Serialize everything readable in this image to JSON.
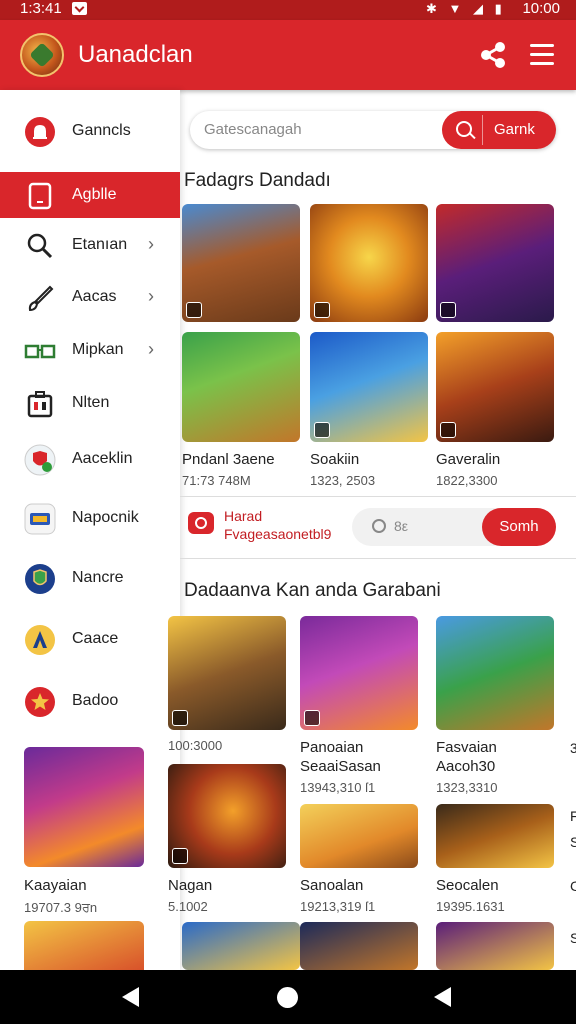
{
  "status_bar": {
    "time_left": "1:3:41",
    "time_right": "10:00",
    "icons": "✱ ▼ ◢ ▮"
  },
  "app_bar": {
    "title": "Uanadclan"
  },
  "search": {
    "placeholder": "Gatescanagah",
    "button_label": "Garnk"
  },
  "sidebar": {
    "items": [
      {
        "label": "Ganncls",
        "icon": "bell-icon",
        "chevron": false,
        "active": false
      },
      {
        "label": "Agblle",
        "icon": "tablet-icon",
        "chevron": false,
        "active": true
      },
      {
        "label": "Etanıan",
        "icon": "search-icon",
        "chevron": true,
        "active": false
      },
      {
        "label": "Aacas",
        "icon": "brush-icon",
        "chevron": true,
        "active": false
      },
      {
        "label": "Mipkan",
        "icon": "glasses-icon",
        "chevron": true,
        "active": false
      },
      {
        "label": "Nlten",
        "icon": "toolbox-icon",
        "chevron": false,
        "active": false
      },
      {
        "label": "Aaceklin",
        "icon": "shield-app-icon",
        "chevron": false,
        "active": false
      },
      {
        "label": "Napocnik",
        "icon": "team-app-icon",
        "chevron": false,
        "active": false
      },
      {
        "label": "Nancre",
        "icon": "globe-app-icon",
        "chevron": false,
        "active": false
      },
      {
        "label": "Caace",
        "icon": "a-logo-icon",
        "chevron": false,
        "active": false
      },
      {
        "label": "Badoo",
        "icon": "star-app-icon",
        "chevron": false,
        "active": false
      }
    ],
    "featured": [
      {
        "name": "Kaayaian",
        "meta": "19707.3 9ਰn"
      }
    ]
  },
  "section1": {
    "title": "Fadagrs Dandadı",
    "cards": [
      {
        "name": "",
        "meta": ""
      },
      {
        "name": "",
        "meta": ""
      },
      {
        "name": "",
        "meta": ""
      },
      {
        "name": "Pndanl 3aene",
        "meta": "71:73 748M"
      },
      {
        "name": "Soakiin",
        "meta": "1323, 2503"
      },
      {
        "name": "Gaveralin",
        "meta": "1822,3300"
      }
    ]
  },
  "promo": {
    "title": "Harad",
    "subtitle": "Fvageasaonetbl9",
    "field_text": "8ε",
    "button_label": "Somh"
  },
  "section2": {
    "title": "Dadaanva Kan anda Garabani",
    "cards": [
      {
        "name": "",
        "meta": "100:3000"
      },
      {
        "name": "Panoaian\nSeaaiSasan",
        "meta": "13943,310 ſ1"
      },
      {
        "name": "Fasvaian\nAacoh30",
        "meta": "1323,3310"
      },
      {
        "name": "Nagan",
        "meta": "5.1002"
      },
      {
        "name": "Sanoalan",
        "meta": "19213,319 ſ1"
      },
      {
        "name": "Seocalen",
        "meta": "19395.1631"
      }
    ]
  },
  "edge_letters": [
    "3",
    "F",
    "S",
    "C",
    "S"
  ]
}
